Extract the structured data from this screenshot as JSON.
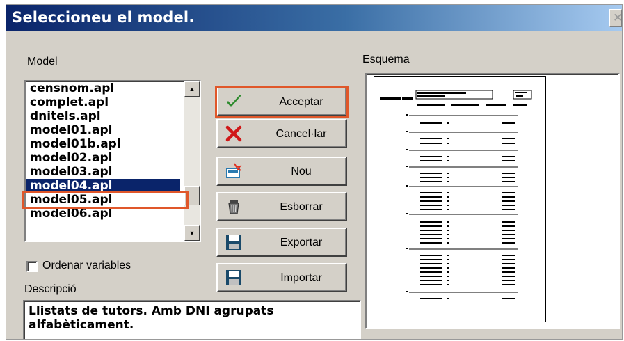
{
  "window": {
    "title": "Seleccioneu el model."
  },
  "model": {
    "label": "Model",
    "items": [
      "censnom.apl",
      "complet.apl",
      "dnitels.apl",
      "model01.apl",
      "model01b.apl",
      "model02.apl",
      "model03.apl",
      "model04.apl",
      "model05.apl",
      "model06.apl"
    ],
    "selected": "model04.apl"
  },
  "buttons": {
    "accept": "Acceptar",
    "cancel": "Cancel·lar",
    "new": "Nou",
    "delete": "Esborrar",
    "export": "Exportar",
    "import": "Importar"
  },
  "options": {
    "sort_variables": "Ordenar variables",
    "sort_variables_checked": false
  },
  "description": {
    "label": "Descripció",
    "text": "Llistats de tutors. Amb DNI agrupats alfabèticament."
  },
  "schema": {
    "label": "Esquema"
  },
  "colors": {
    "title_bar_start": "#0a246a",
    "title_bar_end": "#a6caf0",
    "selection": "#0a246a",
    "highlight_outline": "#e0572a",
    "check_icon": "#2e8b2e",
    "cross_icon": "#d01818"
  },
  "icons": {
    "accept": "checkmark-icon",
    "cancel": "cross-icon",
    "new": "new-document-icon",
    "delete": "trash-icon",
    "export": "floppy-disk-icon",
    "import": "floppy-disk-icon"
  }
}
